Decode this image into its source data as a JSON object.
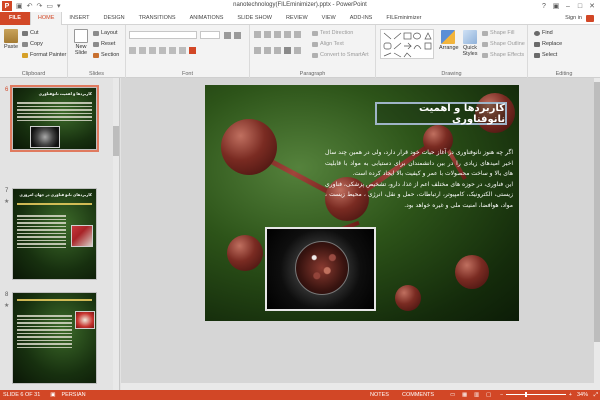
{
  "window": {
    "title": "nanotechnology(FILEminimizer).pptx - PowerPoint",
    "app_logo": "P"
  },
  "tabs": [
    "FILE",
    "HOME",
    "INSERT",
    "DESIGN",
    "TRANSITIONS",
    "ANIMATIONS",
    "SLIDE SHOW",
    "REVIEW",
    "VIEW",
    "ADD-INS",
    "FILEminimizer"
  ],
  "active_tab": "HOME",
  "account": {
    "signin": "Sign in"
  },
  "ribbon": {
    "clipboard": {
      "label": "Clipboard",
      "paste": "Paste",
      "cut": "Cut",
      "copy": "Copy",
      "format_painter": "Format Painter"
    },
    "slides": {
      "label": "Slides",
      "new_slide": "New Slide",
      "layout": "Layout",
      "reset": "Reset",
      "section": "Section"
    },
    "font": {
      "label": "Font"
    },
    "paragraph": {
      "label": "Paragraph",
      "text_direction": "Text Direction",
      "align_text": "Align Text",
      "convert_smartart": "Convert to SmartArt"
    },
    "drawing": {
      "label": "Drawing",
      "arrange": "Arrange",
      "quick_styles": "Quick Styles",
      "shape_fill": "Shape Fill",
      "shape_outline": "Shape Outline",
      "shape_effects": "Shape Effects"
    },
    "editing": {
      "label": "Editing",
      "find": "Find",
      "replace": "Replace",
      "select": "Select"
    }
  },
  "thumbnails": [
    {
      "number": "6",
      "title": "کاربردها و اهمیت نانوفناوری",
      "selected": true
    },
    {
      "number": "7",
      "title": "کاربردهای نانو فناوری در جهان امروزی",
      "selected": false
    },
    {
      "number": "8",
      "title": "",
      "selected": false
    }
  ],
  "slide": {
    "title": "کاربردها و اهمیت نانوفناوری",
    "para1": "اگر چه هنوز نانوفناوری در آغاز حیات خود قرار دارد، ولی در همین چند سال اخیر امیدهای زیادی را در بین دانشمندان برای دستیابی به مواد با قابلیت های بالا و ساخت محصولات با عمر و کیفیت بالا ایجاد کرده است.",
    "para2": "این فناوری، در حوزه های مختلف اعم از غذا، دارو، تشخیص پزشکی، فناوری زیستی، الکترونیک، کامپیوتر، ارتباطات، حمل و نقل، انرژی ، محیط زیست ، مواد، هوافضا، امنیت ملی و غیره خواهد بود."
  },
  "status": {
    "slide_count": "SLIDE 6 OF 31",
    "language": "PERSIAN",
    "notes": "NOTES",
    "comments": "COMMENTS",
    "zoom": "34%",
    "zoom_fraction": 0.34
  },
  "colors": {
    "accent": "#d24726"
  }
}
